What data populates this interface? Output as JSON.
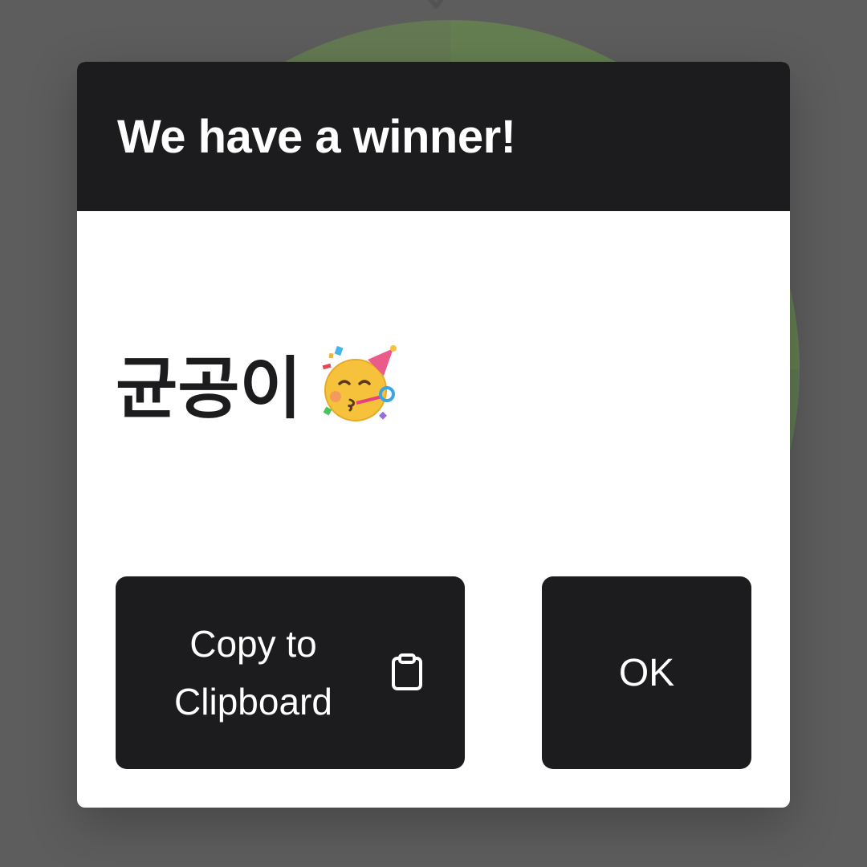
{
  "modal": {
    "title": "We have a winner!",
    "winner": "균공이",
    "winner_emoji": "party-face-icon"
  },
  "buttons": {
    "copy_line1": "Copy to",
    "copy_line2": "Clipboard",
    "copy_icon": "clipboard-icon",
    "ok_label": "OK"
  },
  "colors": {
    "header_bg": "#1c1c1e",
    "button_bg": "#1c1c1e",
    "overlay": "#808080",
    "wheel_green": "#3d7a0a"
  }
}
